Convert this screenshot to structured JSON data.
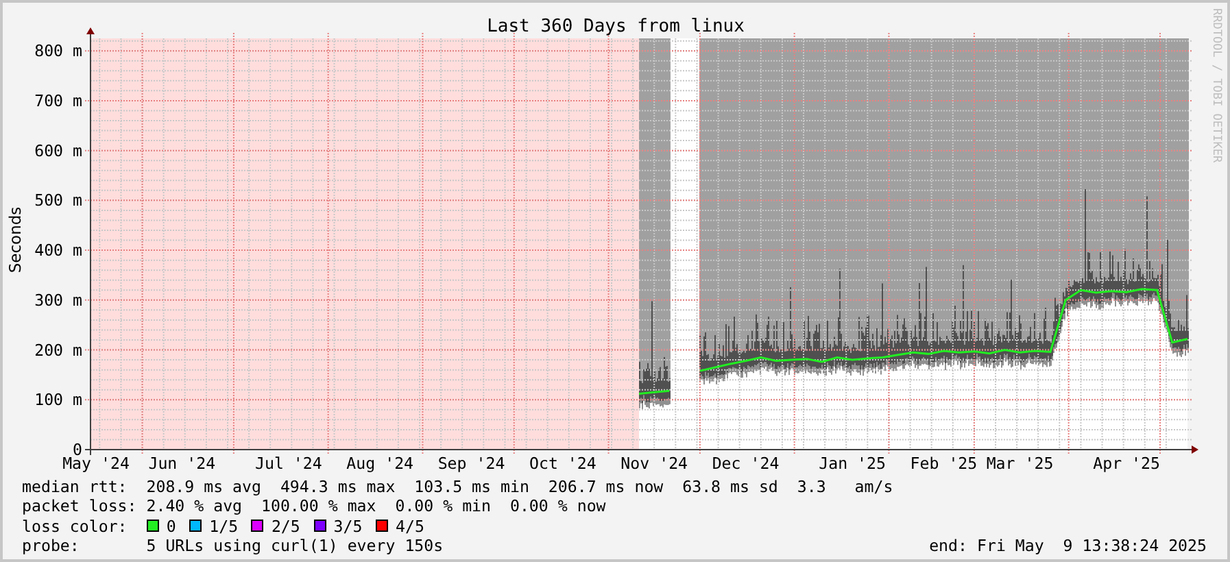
{
  "graph": {
    "credit": "RRDTOOL / TOBI OETIKER",
    "chart_data": {
      "type": "line",
      "grid": true,
      "title": "Last 360 Days from linux",
      "ylabel": "Seconds",
      "ylim": [
        0,
        825
      ],
      "categories": [
        "May '24",
        null,
        null,
        null,
        null,
        null,
        "Jun '24",
        null,
        null,
        null,
        null,
        null,
        null,
        "Jul '24",
        null,
        null,
        null,
        null,
        null,
        "Aug '24",
        null,
        null,
        null,
        null,
        null,
        "Sep '24",
        null,
        null,
        null,
        null,
        null,
        "Oct '24",
        null,
        null,
        null,
        null,
        null,
        "Nov '24",
        null,
        null,
        null,
        null,
        null,
        "Dec '24",
        null,
        null,
        null,
        null,
        null,
        null,
        "Jan '25",
        null,
        null,
        null,
        null,
        null,
        "Feb '25",
        null,
        null,
        null,
        null,
        "Mar '25",
        null,
        null,
        null,
        null,
        null,
        null,
        "Apr '25",
        null,
        null,
        null,
        null
      ],
      "series": [
        {
          "name": "median rtt:",
          "color": "#22ee22",
          "values": [
            null,
            null,
            null,
            null,
            null,
            null,
            null,
            null,
            null,
            null,
            null,
            null,
            null,
            null,
            null,
            null,
            null,
            null,
            null,
            null,
            null,
            null,
            null,
            null,
            null,
            null,
            null,
            null,
            null,
            null,
            null,
            null,
            null,
            null,
            null,
            null,
            112,
            115,
            118,
            null,
            158,
            165,
            172,
            178,
            185,
            178,
            180,
            182,
            176,
            185,
            180,
            183,
            185,
            190,
            195,
            192,
            198,
            195,
            197,
            193,
            200,
            195,
            198,
            196,
            300,
            320,
            315,
            318,
            316,
            322,
            320,
            215,
            222
          ]
        }
      ],
      "yticks": [
        {
          "value": 0,
          "label": "0"
        },
        {
          "value": 100,
          "label": "100 m"
        },
        {
          "value": 200,
          "label": "200 m"
        },
        {
          "value": 300,
          "label": "300 m"
        },
        {
          "value": 400,
          "label": "400 m"
        },
        {
          "value": 500,
          "label": "500 m"
        },
        {
          "value": 600,
          "label": "600 m"
        },
        {
          "value": 700,
          "label": "700 m"
        },
        {
          "value": 800,
          "label": "800 m"
        }
      ]
    }
  },
  "legend": {
    "median_rtt": {
      "text": "208.9 ms avg  494.3 ms max  103.5 ms min  206.7 ms now  63.8 ms sd  3.3   am/s"
    },
    "packet_loss": {
      "label": "packet loss:",
      "text": "2.40 % avg  100.00 % max  0.00 % min  0.00 % now"
    },
    "loss_color": {
      "label": "loss color:",
      "items": [
        {
          "label": "0",
          "color": "#22ee22"
        },
        {
          "label": "1/5",
          "color": "#00b8ff"
        },
        {
          "label": "2/5",
          "color": "#dd00ff"
        },
        {
          "label": "3/5",
          "color": "#7e00ff"
        },
        {
          "label": "4/5",
          "color": "#ff0000"
        }
      ]
    },
    "probe": {
      "label": "probe:",
      "text": "5 URLs using curl(1) every 150s"
    },
    "end": "end: Fri May  9 13:38:24 2025"
  }
}
